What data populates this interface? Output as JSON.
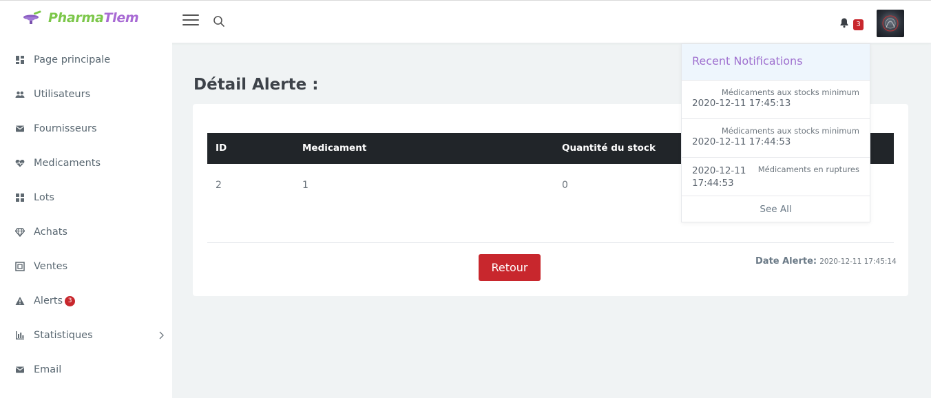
{
  "brand": {
    "part1": "Pharma",
    "part2": "Tlem"
  },
  "header": {
    "notification_count": "3"
  },
  "sidebar": {
    "items": [
      {
        "label": "Page principale",
        "icon": "dashboard-icon"
      },
      {
        "label": "Utilisateurs",
        "icon": "users-icon"
      },
      {
        "label": "Fournisseurs",
        "icon": "mail-icon"
      },
      {
        "label": "Medicaments",
        "icon": "heartbeat-icon"
      },
      {
        "label": "Lots",
        "icon": "grid-icon"
      },
      {
        "label": "Achats",
        "icon": "diamond-icon"
      },
      {
        "label": "Ventes",
        "icon": "frame-icon"
      },
      {
        "label": "Alerts",
        "icon": "warning-icon",
        "badge": "3"
      },
      {
        "label": "Statistiques",
        "icon": "bar-chart-icon"
      },
      {
        "label": "Email",
        "icon": "mail-icon"
      }
    ]
  },
  "main": {
    "title": "Détail Alerte :",
    "table": {
      "headers": [
        "ID",
        "Medicament",
        "Quantité du stock"
      ],
      "row": [
        "2",
        "1",
        "0"
      ]
    },
    "retour_label": "Retour",
    "date_label": "Date Alerte:",
    "date_value": "2020-12-11 17:45:14"
  },
  "notifications": {
    "title": "Recent Notifications",
    "items": [
      {
        "message": "Médicaments aux stocks minimum",
        "date": "2020-12-11 17:45:13"
      },
      {
        "message": "Médicaments aux stocks minimum",
        "date": "2020-12-11 17:44:53"
      },
      {
        "message": "Médicaments en ruptures",
        "date": "2020-12-11 17:44:53"
      }
    ],
    "see_all": "See All"
  },
  "colors": {
    "brand_purple": "#a86ad4",
    "brand_green": "#7cc74a",
    "danger": "#c8272d",
    "table_header": "#212529"
  }
}
